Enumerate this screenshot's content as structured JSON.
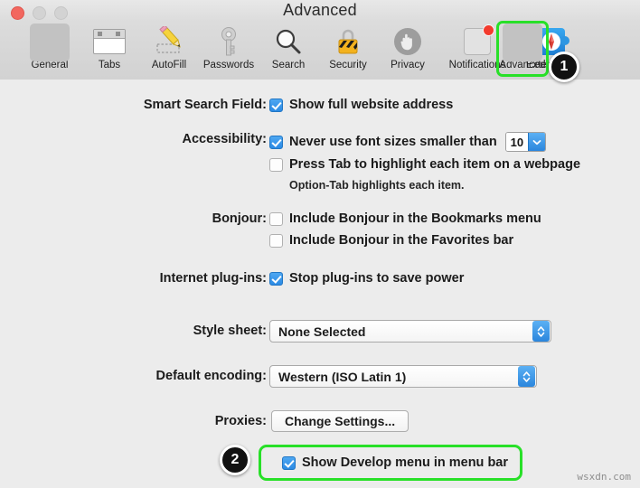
{
  "window": {
    "title": "Advanced",
    "traffic_lights": [
      {
        "name": "close",
        "color": "#f2675f"
      },
      {
        "name": "minimize",
        "color": "#d3d3d3"
      },
      {
        "name": "zoom",
        "color": "#d3d3d3"
      }
    ]
  },
  "toolbar": {
    "items": [
      {
        "label": "General",
        "icon": "iphone-icon",
        "selected": true,
        "highlighted": false
      },
      {
        "label": "Tabs",
        "icon": "tabs-window-icon",
        "selected": false,
        "highlighted": false
      },
      {
        "label": "AutoFill",
        "icon": "pencil-form-icon",
        "selected": false,
        "highlighted": false
      },
      {
        "label": "Passwords",
        "icon": "key-icon",
        "selected": false,
        "highlighted": false
      },
      {
        "label": "Search",
        "icon": "magnifier-icon",
        "selected": false,
        "highlighted": false
      },
      {
        "label": "Security",
        "icon": "padlock-icon",
        "selected": false,
        "highlighted": false
      },
      {
        "label": "Privacy",
        "icon": "hand-icon",
        "selected": false,
        "highlighted": false
      },
      {
        "label": "Notifications",
        "icon": "notification-icon",
        "selected": false,
        "highlighted": false
      },
      {
        "label": "Extensions",
        "icon": "puzzle-compass-icon",
        "selected": false,
        "highlighted": false
      },
      {
        "label": "Advanced",
        "icon": "gear-icon",
        "selected": true,
        "highlighted": true
      }
    ]
  },
  "settings": {
    "smart_search_field": {
      "label": "Smart Search Field:",
      "checkbox_label": "Show full website address",
      "checked": true
    },
    "accessibility": {
      "label": "Accessibility:",
      "font_size_option": {
        "checkbox_label": "Never use font sizes smaller than",
        "checked": true,
        "value": "10"
      },
      "tab_option": {
        "checkbox_label": "Press Tab to highlight each item on a webpage",
        "checked": false
      },
      "hint": "Option-Tab highlights each item."
    },
    "bonjour": {
      "label": "Bonjour:",
      "options": [
        {
          "checkbox_label": "Include Bonjour in the Bookmarks menu",
          "checked": false
        },
        {
          "checkbox_label": "Include Bonjour in the Favorites bar",
          "checked": false
        }
      ]
    },
    "internet_plugins": {
      "label": "Internet plug-ins:",
      "checkbox_label": "Stop plug-ins to save power",
      "checked": true
    },
    "style_sheet": {
      "label": "Style sheet:",
      "value": "None Selected"
    },
    "default_encoding": {
      "label": "Default encoding:",
      "value": "Western (ISO Latin 1)"
    },
    "proxies": {
      "label": "Proxies:",
      "button_label": "Change Settings..."
    },
    "develop_menu": {
      "checkbox_label": "Show Develop menu in menu bar",
      "checked": true
    }
  },
  "annotations": {
    "highlight_color": "#28e028",
    "steps": [
      {
        "number": "1",
        "target": "Advanced toolbar item"
      },
      {
        "number": "2",
        "target": "Show Develop menu in menu bar"
      }
    ]
  },
  "watermark": "wsxdn.com"
}
